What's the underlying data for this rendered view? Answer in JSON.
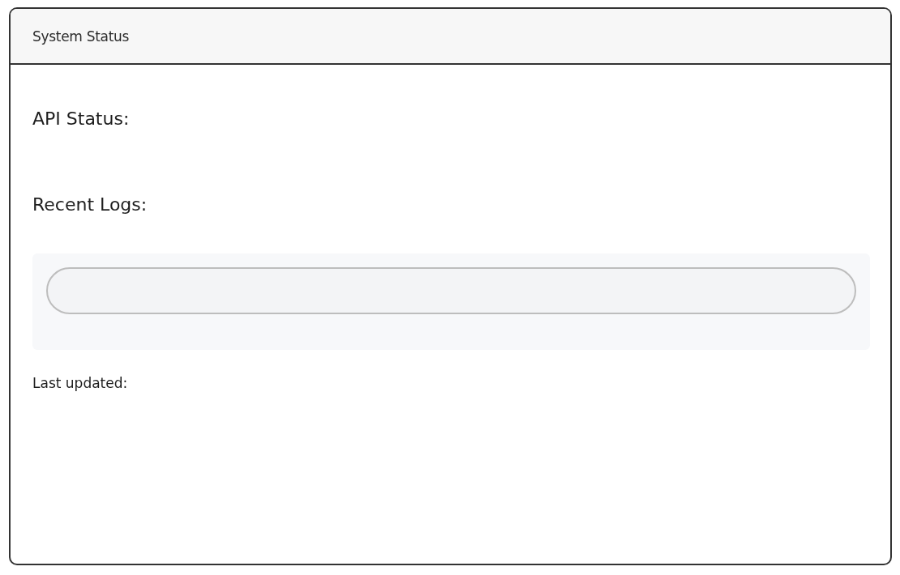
{
  "window": {
    "title": "System Status"
  },
  "api_status": {
    "label": "API Status:"
  },
  "logs": {
    "label": "Recent Logs:"
  },
  "last_updated": {
    "label": "Last updated:"
  }
}
